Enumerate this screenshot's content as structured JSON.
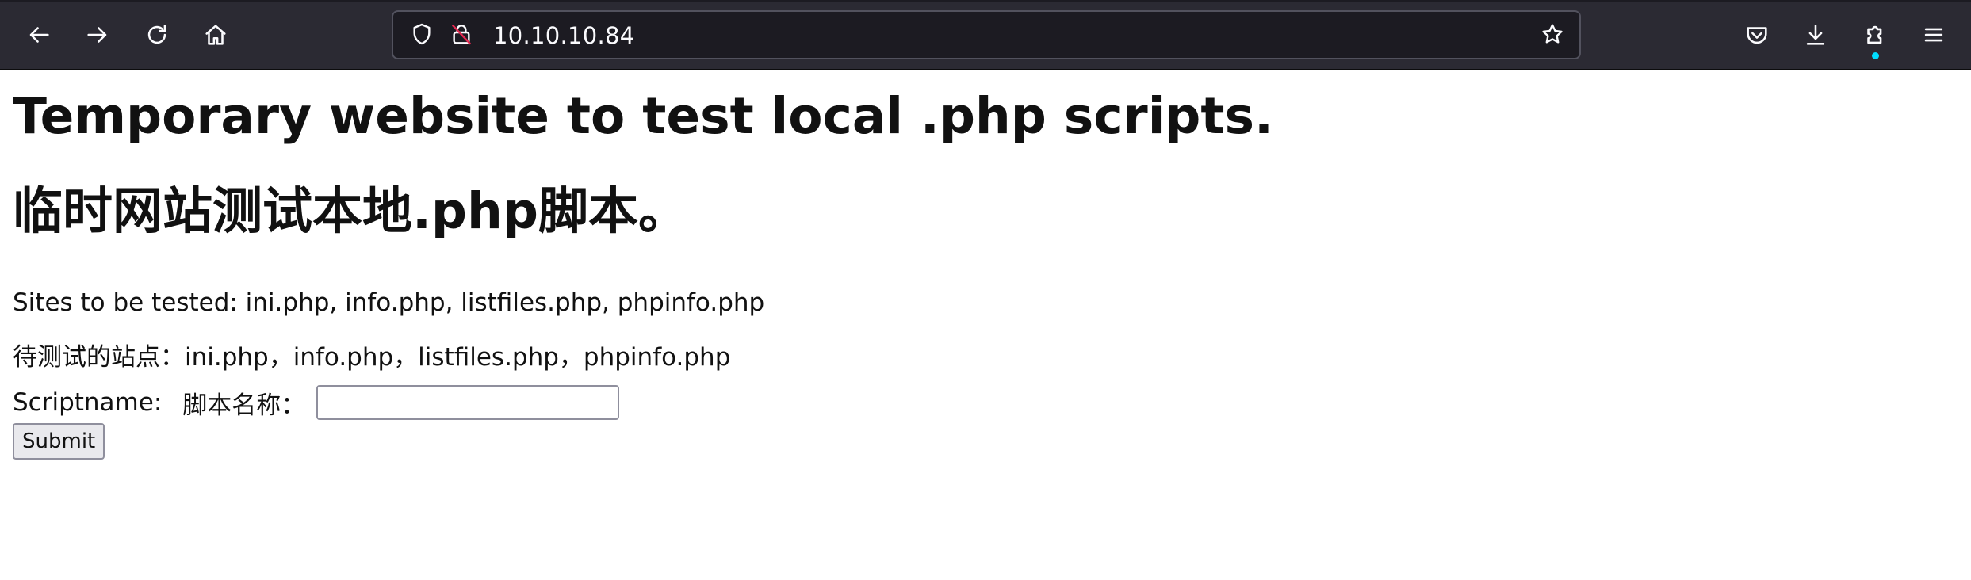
{
  "browser": {
    "url": "10.10.10.84",
    "icons": {
      "back": "back-arrow-icon",
      "forward": "forward-arrow-icon",
      "reload": "reload-icon",
      "home": "home-icon",
      "tracking": "shield-icon",
      "insecure": "insecure-lock-icon",
      "bookmark": "star-icon",
      "pocket": "pocket-icon",
      "downloads": "download-icon",
      "extensions": "puzzle-icon",
      "menu": "hamburger-menu-icon"
    },
    "colors": {
      "toolbar": "#2b2a33",
      "urlbar": "#1c1b22",
      "icon": "#fbfbfe",
      "insecure_slash": "#e22850",
      "extension_dot": "#00ddff"
    }
  },
  "page": {
    "title_en": "Temporary website to test local .php scripts.",
    "title_zh": "临时网站测试本地.php脚本。",
    "sites_en": "Sites to be tested: ini.php, info.php, listfiles.php, phpinfo.php",
    "sites_zh": "待测试的站点：ini.php，info.php，listfiles.php，phpinfo.php",
    "form": {
      "label_en": "Scriptname:",
      "label_zh": "脚本名称：",
      "input_value": "",
      "submit_label": "Submit"
    }
  }
}
